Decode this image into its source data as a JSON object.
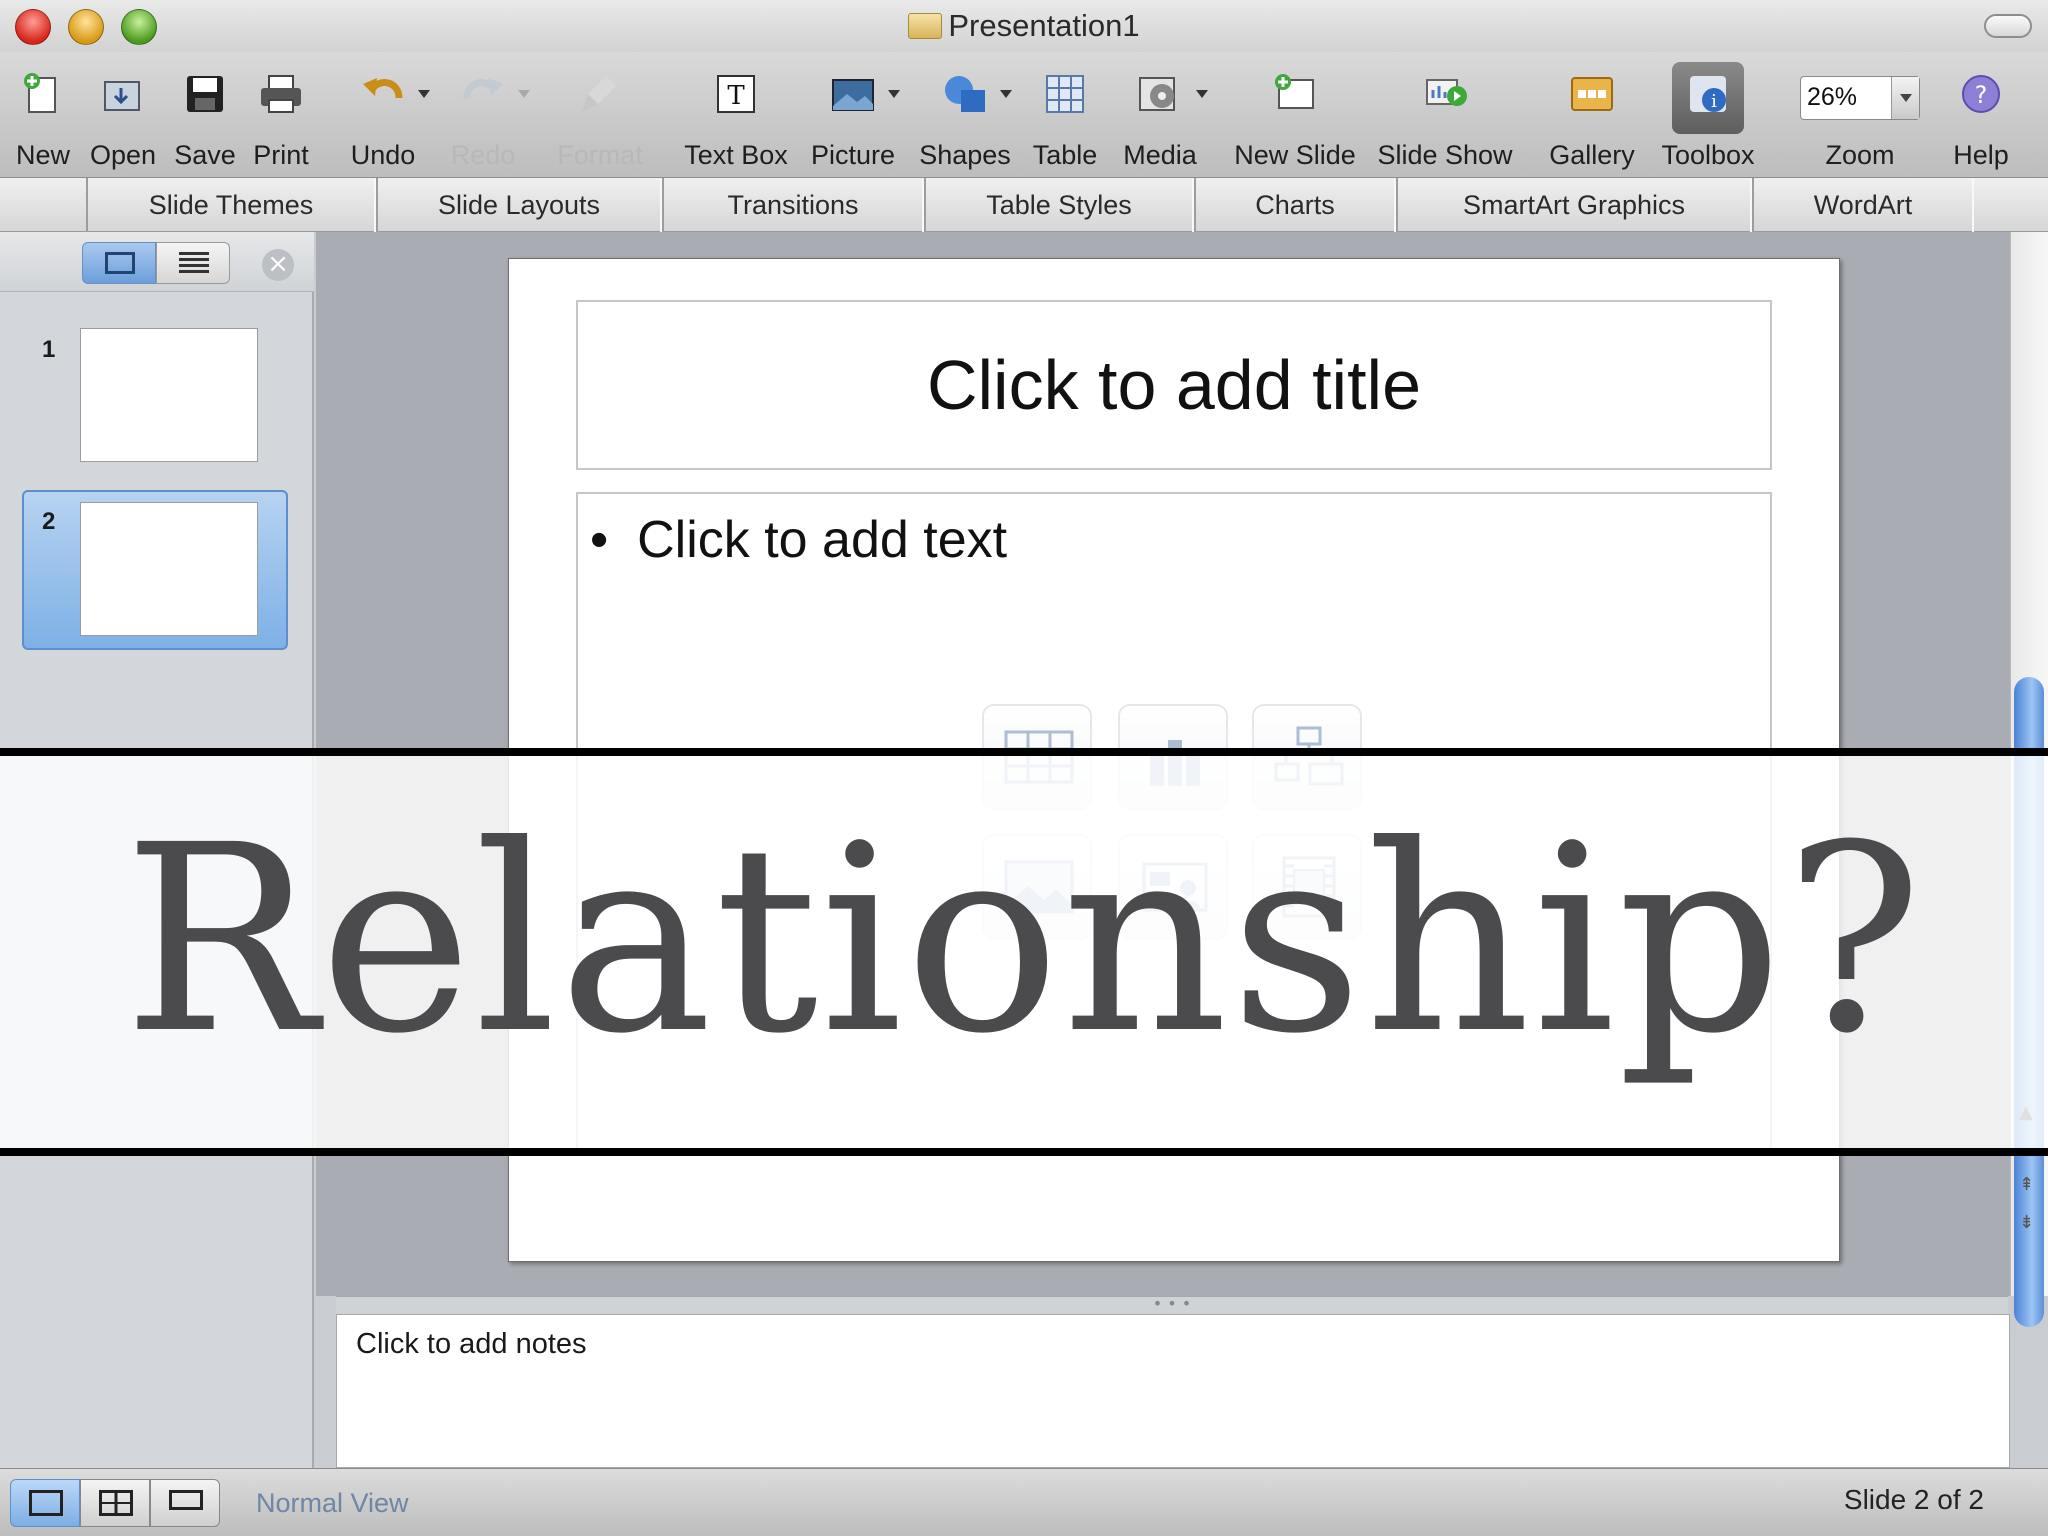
{
  "window": {
    "title": "Presentation1"
  },
  "toolbar": {
    "items": [
      {
        "label": "New",
        "icon": "new-document-icon"
      },
      {
        "label": "Open",
        "icon": "open-folder-icon"
      },
      {
        "label": "Save",
        "icon": "floppy-disk-icon"
      },
      {
        "label": "Print",
        "icon": "printer-icon"
      },
      {
        "label": "Undo",
        "icon": "undo-icon"
      },
      {
        "label": "Redo",
        "icon": "redo-icon",
        "disabled": true
      },
      {
        "label": "Format",
        "icon": "format-brush-icon",
        "disabled": true
      },
      {
        "label": "Text Box",
        "icon": "text-box-icon"
      },
      {
        "label": "Picture",
        "icon": "picture-icon"
      },
      {
        "label": "Shapes",
        "icon": "shapes-icon"
      },
      {
        "label": "Table",
        "icon": "table-icon"
      },
      {
        "label": "Media",
        "icon": "media-icon"
      },
      {
        "label": "New Slide",
        "icon": "new-slide-icon"
      },
      {
        "label": "Slide Show",
        "icon": "slide-show-icon"
      },
      {
        "label": "Gallery",
        "icon": "gallery-icon"
      },
      {
        "label": "Toolbox",
        "icon": "toolbox-icon",
        "active": true
      },
      {
        "label": "Zoom",
        "icon": "zoom-field"
      },
      {
        "label": "Help",
        "icon": "help-icon"
      }
    ],
    "zoom_value": "26%"
  },
  "ribbon": {
    "tabs": [
      "Slide Themes",
      "Slide Layouts",
      "Transitions",
      "Table Styles",
      "Charts",
      "SmartArt Graphics",
      "WordArt"
    ]
  },
  "sidebar": {
    "slides": [
      {
        "number": "1",
        "selected": false
      },
      {
        "number": "2",
        "selected": true
      }
    ]
  },
  "slide": {
    "title_placeholder": "Click to add title",
    "body_placeholder": "Click to add text",
    "bullet": "•",
    "insert_icons": [
      "insert-table-icon",
      "insert-chart-icon",
      "insert-smartart-icon",
      "insert-picture-icon",
      "insert-clipart-icon",
      "insert-movie-icon"
    ]
  },
  "notes": {
    "placeholder": "Click to add notes"
  },
  "status": {
    "view_label": "Normal View",
    "slide_position": "Slide 2 of 2"
  },
  "overlay": {
    "text": "Relationship?"
  },
  "colors": {
    "selection_blue": "#7eb0e6",
    "overlay_text": "#4b4b4e",
    "canvas_bg": "#a9acb2"
  }
}
